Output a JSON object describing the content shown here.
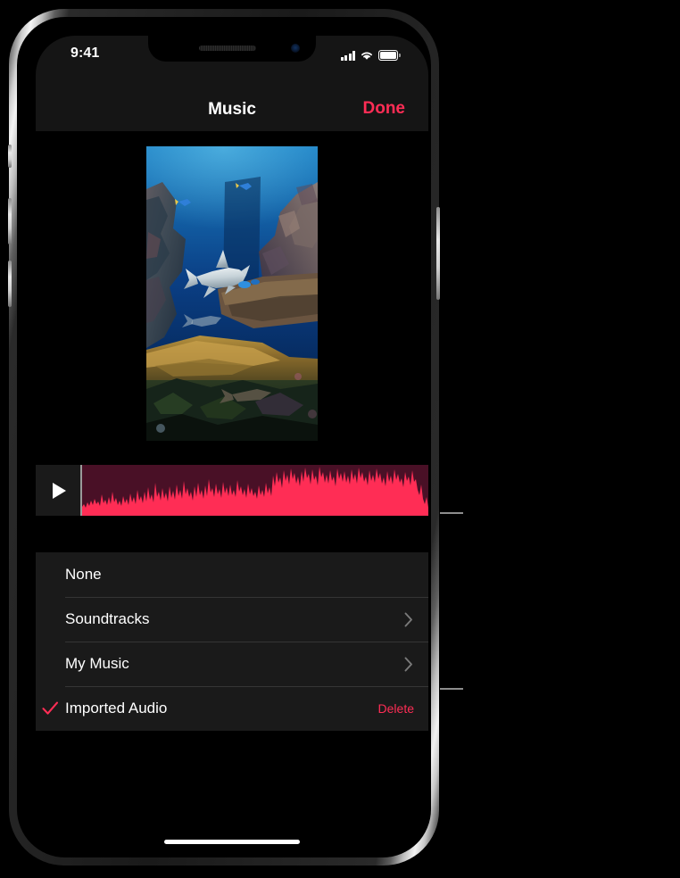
{
  "status_bar": {
    "time": "9:41",
    "cellular_icon": "cellular-bars-icon",
    "wifi_icon": "wifi-icon",
    "battery_icon": "battery-full-icon"
  },
  "nav_bar": {
    "title": "Music",
    "done_label": "Done"
  },
  "video_preview": {
    "description": "underwater coral reef with shark"
  },
  "audio_track": {
    "play_icon": "play-triangle-icon",
    "waveform_color": "#ff2d55",
    "waveform_background": "#491026",
    "playhead_color": "#9a9a9a"
  },
  "options": [
    {
      "label": "None",
      "checked": false,
      "accessory": "none"
    },
    {
      "label": "Soundtracks",
      "checked": false,
      "accessory": "chevron"
    },
    {
      "label": "My Music",
      "checked": false,
      "accessory": "chevron"
    },
    {
      "label": "Imported Audio",
      "checked": true,
      "accessory": "delete",
      "delete_label": "Delete"
    }
  ],
  "theme": {
    "accent": "#ff2d55",
    "list_background": "#1a1a1a",
    "chrome_background": "#151515",
    "text": "#ffffff",
    "separator": "#353535",
    "chevron": "#7a7a7a",
    "callout_line": "#8d8d8d"
  },
  "home_indicator": "home-indicator-bar",
  "callouts": [
    {
      "target": "play-button"
    },
    {
      "target": "delete-button"
    }
  ]
}
